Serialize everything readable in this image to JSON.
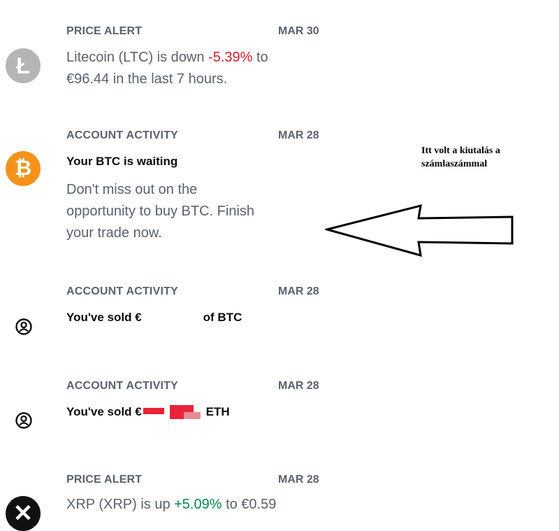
{
  "notifications": [
    {
      "category": "PRICE ALERT",
      "date": "MAR 30",
      "icon": "litecoin-icon",
      "text_before": "Litecoin (LTC) is down ",
      "change": "-5.39%",
      "text_after_line1": " to",
      "text_line2": "€96.44 in the last 7 hours."
    },
    {
      "category": "ACCOUNT ACTIVITY",
      "date": "MAR 28",
      "icon": "bitcoin-icon",
      "headline": "Your BTC is waiting",
      "body_line1": "Don't miss out on the",
      "body_line2": "opportunity to buy BTC. Finish",
      "body_line3": "your trade now."
    },
    {
      "category": "ACCOUNT ACTIVITY",
      "date": "MAR 28",
      "icon": "user-circle-icon",
      "headline_start": "You've sold €",
      "headline_end": "of BTC"
    },
    {
      "category": "ACCOUNT ACTIVITY",
      "date": "MAR 28",
      "icon": "user-circle-icon",
      "headline_start": "You've sold €",
      "headline_end": "ETH"
    },
    {
      "category": "PRICE ALERT",
      "date": "MAR 28",
      "icon": "xrp-icon",
      "text_before": "XRP (XRP) is up ",
      "change": "+5.09%",
      "text_after": " to €0.59"
    }
  ],
  "annotation": {
    "line1": "Itt volt a kiutalás a",
    "line2": "számlaszámmal"
  },
  "colors": {
    "negative": "#cf202f",
    "positive": "#098551",
    "bitcoin": "#f7931a",
    "litecoin": "#b5b5b5"
  }
}
